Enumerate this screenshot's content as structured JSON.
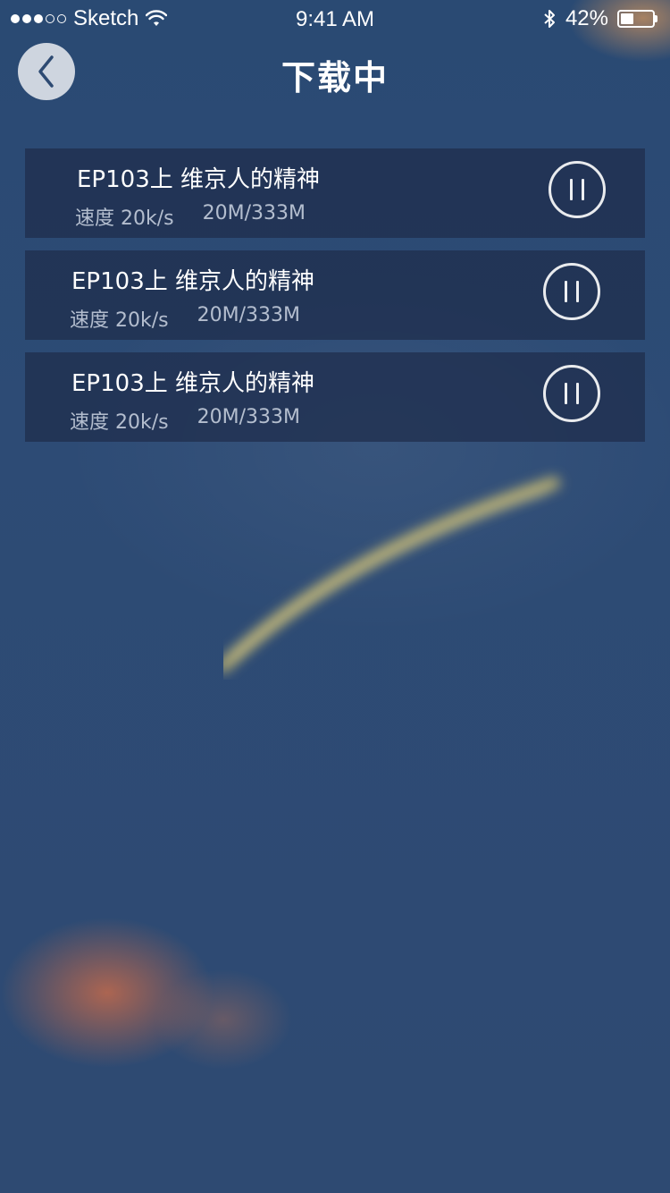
{
  "status_bar": {
    "carrier": "Sketch",
    "time": "9:41 AM",
    "battery_percent": "42%",
    "battery_level": 0.42,
    "signal_icon": "signal-dots-icon",
    "wifi_icon": "wifi-icon",
    "bluetooth_icon": "bluetooth-icon"
  },
  "nav": {
    "title": "下载中",
    "back_icon": "chevron-left-icon"
  },
  "downloads": [
    {
      "title": "EP103上  维京人的精神",
      "speed": "速度 20k/s",
      "size": "20M/333M",
      "action_icon": "pause-icon"
    },
    {
      "title": "EP103上  维京人的精神",
      "speed": "速度 20k/s",
      "size": "20M/333M",
      "action_icon": "pause-icon"
    },
    {
      "title": "EP103上  维京人的精神",
      "speed": "速度 20k/s",
      "size": "20M/333M",
      "action_icon": "pause-icon"
    }
  ],
  "colors": {
    "background": "#2d4a72",
    "list_item_bg": "#1e2d4b",
    "accent_orange": "#d66e46",
    "streak_yellow": "#e8d070"
  }
}
